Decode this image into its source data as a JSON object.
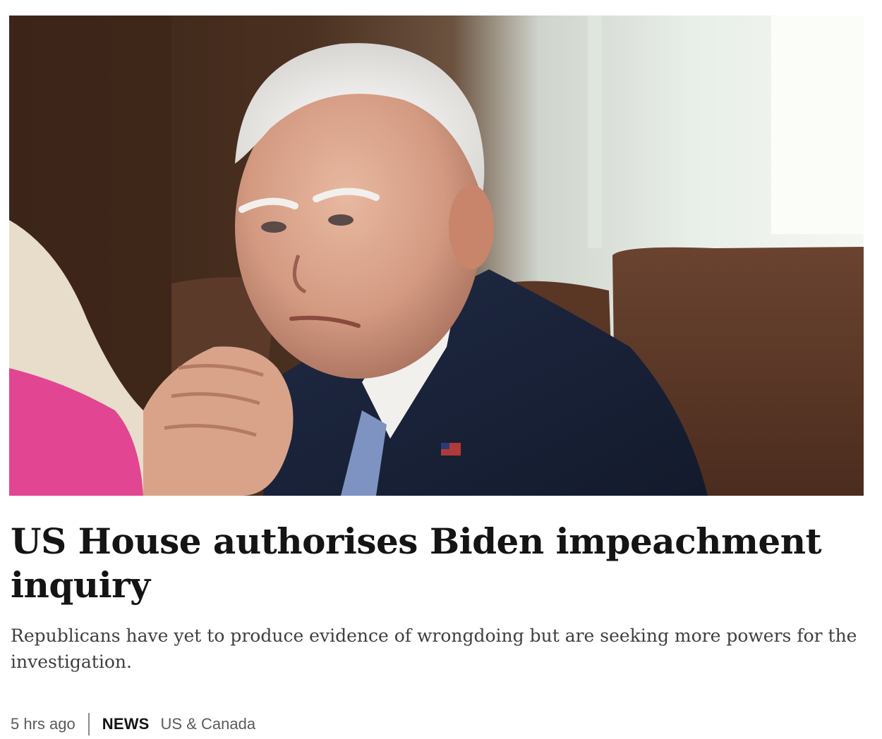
{
  "article": {
    "image_alt": "Joe Biden with hands clasped at a cabinet meeting",
    "headline": "US House authorises Biden impeachment inquiry",
    "summary": "Republicans have yet to produce evidence of wrongdoing but are seeking more powers for the investigation.",
    "time": "5 hrs ago",
    "brand": "NEWS",
    "section": "US & Canada"
  },
  "colors": {
    "headline": "#141414",
    "summary": "#3f3f42",
    "meta": "#5a5a5a",
    "brand": "#141414"
  }
}
